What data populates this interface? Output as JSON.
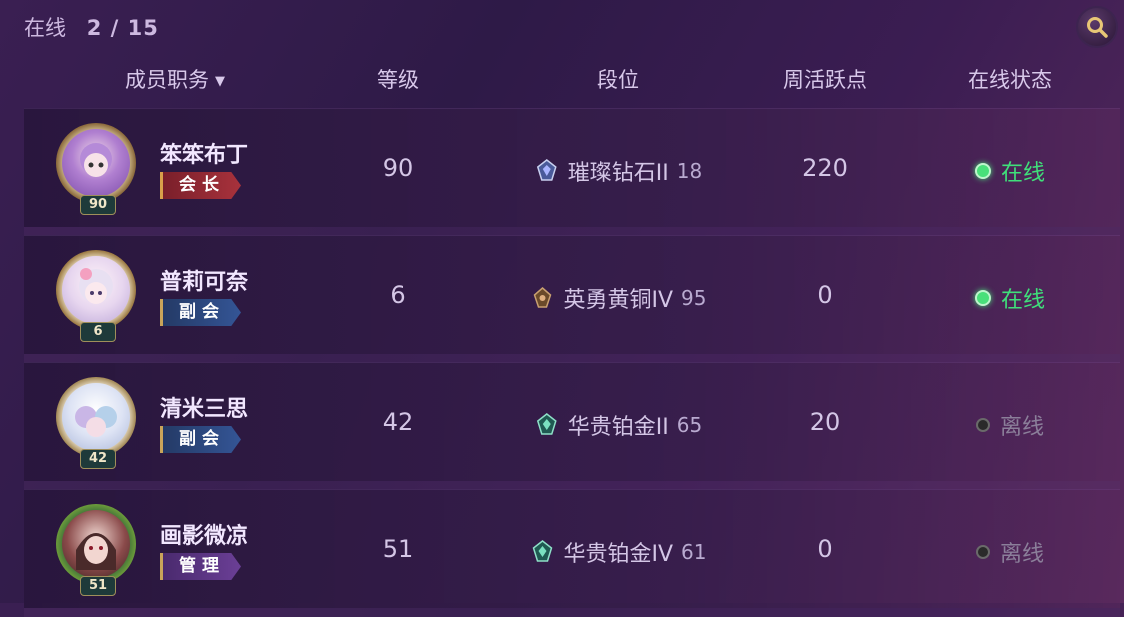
{
  "topbar": {
    "label": "在线",
    "count": "2 / 15"
  },
  "header": {
    "role": "成员职务",
    "level": "等级",
    "rank": "段位",
    "active": "周活跃点",
    "status": "在线状态"
  },
  "members": [
    {
      "name": "笨笨布丁",
      "avatar_level": "90",
      "role": "会长",
      "level": "90",
      "rank_name": "璀璨钻石II",
      "rank_points": "18",
      "active": "220",
      "status": "在线",
      "online": true
    },
    {
      "name": "普莉可奈",
      "avatar_level": "6",
      "role": "副会",
      "level": "6",
      "rank_name": "英勇黄铜IV",
      "rank_points": "95",
      "active": "0",
      "status": "在线",
      "online": true
    },
    {
      "name": "清米三思",
      "avatar_level": "42",
      "role": "副会",
      "level": "42",
      "rank_name": "华贵铂金II",
      "rank_points": "65",
      "active": "20",
      "status": "离线",
      "online": false
    },
    {
      "name": "画影微凉",
      "avatar_level": "51",
      "role": "管理",
      "level": "51",
      "rank_name": "华贵铂金IV",
      "rank_points": "61",
      "active": "0",
      "status": "离线",
      "online": false
    }
  ],
  "colors": {
    "online": "#3fe07a",
    "offline": "#8b7f9a",
    "leader": "#a8323c",
    "vice": "#345596",
    "admin": "#6b3f96"
  }
}
